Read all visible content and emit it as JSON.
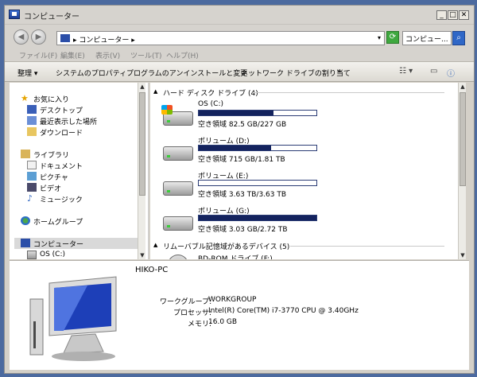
{
  "window": {
    "title": "コンピューター"
  },
  "nav": {
    "back_label": "◀",
    "forward_label": "▶",
    "address_text": "▸ コンピューター ▸",
    "address_dropdown": "▾",
    "refresh_label": "⟳",
    "search_placeholder": "コンピュー...",
    "search_icon": "search-icon"
  },
  "menu": {
    "file": "ファイル(F)",
    "edit": "編集(E)",
    "view": "表示(V)",
    "tools": "ツール(T)",
    "help": "ヘルプ(H)"
  },
  "toolbar": {
    "organize": "整理 ▾",
    "system_properties": "システムのプロパティ",
    "uninstall": "プログラムのアンインストールと変更",
    "map_drive": "ネットワーク ドライブの割り当て",
    "more": "»"
  },
  "sidebar": {
    "favorites": "お気に入り",
    "desktop": "デスクトップ",
    "recent": "最近表示した場所",
    "downloads": "ダウンロード",
    "libraries": "ライブラリ",
    "documents": "ドキュメント",
    "pictures": "ピクチャ",
    "videos": "ビデオ",
    "music": "ミュージック",
    "homegroup": "ホームグループ",
    "computer": "コンピューター",
    "os_c": "OS (C:)"
  },
  "content": {
    "hdd_group": "ハード ディスク ドライブ (4)",
    "removable_group": "リムーバブル記憶域があるデバイス (5)",
    "drives": [
      {
        "name": "OS (C:)",
        "space": "空き領域 82.5 GB/227 GB",
        "used": 0.636
      },
      {
        "name": "ボリューム (D:)",
        "space": "空き領域 715 GB/1.81 TB",
        "used": 0.614
      },
      {
        "name": "ボリューム (E:)",
        "space": "空き領域 3.63 TB/3.63 TB",
        "used": 0.0
      },
      {
        "name": "ボリューム (G:)",
        "space": "空き領域 3.03 GB/2.72 TB",
        "used": 0.999
      }
    ],
    "bd_drive": "BD-ROM ドライブ (F:)"
  },
  "details": {
    "pc_name": "HIKO-PC",
    "workgroup_label": "ワークグループ:",
    "workgroup_value": "WORKGROUP",
    "processor_label": "プロセッサ:",
    "processor_value": "Intel(R) Core(TM) i7-3770 CPU @ 3.40GHz",
    "memory_label": "メモリ:",
    "memory_value": "16.0 GB"
  }
}
